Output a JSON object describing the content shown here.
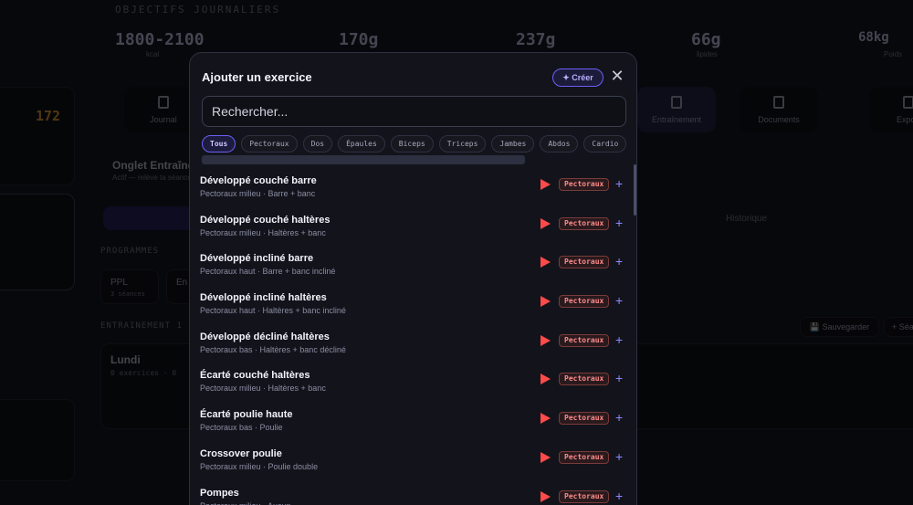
{
  "background": {
    "objectives_title": "OBJECTIFS JOURNALIERS",
    "stats": [
      {
        "value": "1800-2100",
        "label": "kcal"
      },
      {
        "value": "170g",
        "label": ""
      },
      {
        "value": "237g",
        "label": ""
      },
      {
        "value": "66g",
        "label": "lipides"
      },
      {
        "value": "68kg",
        "label": "Poids"
      }
    ],
    "nav": [
      {
        "label": "Journal"
      },
      {
        "label": "Entraînement"
      },
      {
        "label": "Documents"
      },
      {
        "label": "Export"
      }
    ],
    "tab_title": "Onglet Entraînement",
    "tab_subtitle": "Actif — relève ta séance",
    "history_tab": "Historique",
    "programs_label": "PROGRAMMES",
    "program_ppl": "PPL",
    "program_ppl_sub": "3 séances",
    "program_2": "En",
    "training_label": "ENTRAINEMENT 1",
    "save_button": "💾 Sauvegarder",
    "see_button": "+ Séa",
    "day_title": "Lundi",
    "day_sub": "0 exercices · 0",
    "side_num": "172"
  },
  "modal": {
    "title": "Ajouter un exercice",
    "create_label": "✦ Créer",
    "close_label": "✕",
    "search_placeholder": "Rechercher..."
  },
  "filters": [
    "Tous",
    "Pectoraux",
    "Dos",
    "Épaules",
    "Biceps",
    "Triceps",
    "Jambes",
    "Abdos",
    "Cardio"
  ],
  "active_filter": "Tous",
  "exercises": [
    {
      "name": "Développé couché barre",
      "sub": "Pectoraux milieu · Barre + banc",
      "tag": "Pectoraux"
    },
    {
      "name": "Développé couché haltères",
      "sub": "Pectoraux milieu · Haltères + banc",
      "tag": "Pectoraux"
    },
    {
      "name": "Développé incliné barre",
      "sub": "Pectoraux haut · Barre + banc incliné",
      "tag": "Pectoraux"
    },
    {
      "name": "Développé incliné haltères",
      "sub": "Pectoraux haut · Haltères + banc incliné",
      "tag": "Pectoraux"
    },
    {
      "name": "Développé décliné haltères",
      "sub": "Pectoraux bas · Haltères + banc décliné",
      "tag": "Pectoraux"
    },
    {
      "name": "Écarté couché haltères",
      "sub": "Pectoraux milieu · Haltères + banc",
      "tag": "Pectoraux"
    },
    {
      "name": "Écarté poulie haute",
      "sub": "Pectoraux bas · Poulie",
      "tag": "Pectoraux"
    },
    {
      "name": "Crossover poulie",
      "sub": "Pectoraux milieu · Poulie double",
      "tag": "Pectoraux"
    },
    {
      "name": "Pompes",
      "sub": "Pectoraux milieu · Aucun",
      "tag": "Pectoraux"
    }
  ],
  "colors": {
    "accent": "#6a5ff5",
    "play": "#ff4a4a",
    "tag": "#ff8a8a"
  }
}
